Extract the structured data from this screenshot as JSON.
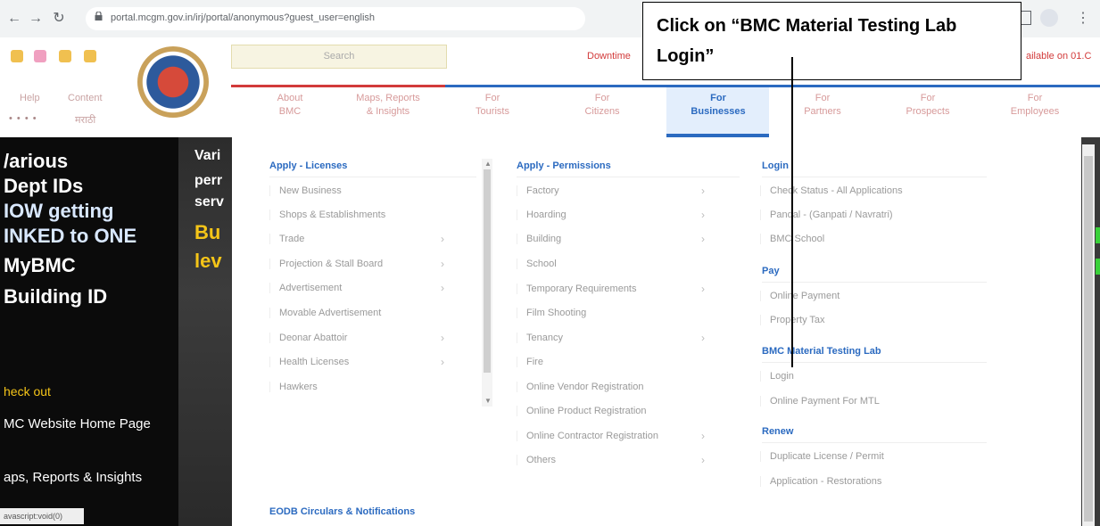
{
  "browser": {
    "url": "portal.mcgm.gov.in/irj/portal/anonymous?guest_user=english"
  },
  "header": {
    "search_placeholder": "Search",
    "ticker_left": "Downtime",
    "ticker_right": "ailable on 01.C",
    "help": "Help",
    "content": "Content",
    "languages": "• • • •",
    "marathi": "मराठी"
  },
  "nav": [
    {
      "line1": "About",
      "line2": "BMC"
    },
    {
      "line1": "Maps, Reports",
      "line2": "& Insights"
    },
    {
      "line1": "For",
      "line2": "Tourists"
    },
    {
      "line1": "For",
      "line2": "Citizens"
    },
    {
      "line1": "For",
      "line2": "Businesses"
    },
    {
      "line1": "For",
      "line2": "Partners"
    },
    {
      "line1": "For",
      "line2": "Prospects"
    },
    {
      "line1": "For",
      "line2": "Employees"
    }
  ],
  "banner": {
    "l1": "/arious",
    "l2": "Dept IDs",
    "l3": "IOW getting",
    "l4": "INKED to ONE",
    "l5": "MyBMC",
    "l6": "Building ID",
    "r1": "Vari",
    "r2": "perr",
    "r3": "serv",
    "r4": "Bu",
    "r5": "lev",
    "check": "heck out",
    "link1": "MC Website Home Page",
    "link2": "aps, Reports & Insights",
    "status": "avascript:void(0)"
  },
  "menu": {
    "col1": {
      "heading": "Apply - Licenses",
      "items": [
        "New Business",
        "Shops & Establishments",
        "Trade",
        "Projection & Stall Board",
        "Advertisement",
        "Movable Advertisement",
        "Deonar Abattoir",
        "Health Licenses",
        "Hawkers"
      ],
      "footer_heading": "EODB Circulars & Notifications"
    },
    "col2": {
      "heading": "Apply - Permissions",
      "items": [
        "Factory",
        "Hoarding",
        "Building",
        "School",
        "Temporary Requirements",
        "Film Shooting",
        "Tenancy",
        "Fire",
        "Online Vendor Registration",
        "Online Product Registration",
        "Online Contractor Registration",
        "Others"
      ]
    },
    "col3": {
      "login_heading": "Login",
      "login_items": [
        "Check Status - All Applications",
        "Pandal - (Ganpati / Navratri)",
        "BMC School"
      ],
      "pay_heading": "Pay",
      "pay_items": [
        "Online Payment",
        "Property Tax"
      ],
      "lab_heading": "BMC Material Testing Lab",
      "lab_items": [
        "Login",
        "Online Payment For MTL"
      ],
      "renew_heading": "Renew",
      "renew_items": [
        "Duplicate License / Permit",
        "Application - Restorations"
      ]
    }
  },
  "annotation": {
    "text": "Click on “BMC Material Testing Lab Login”"
  }
}
